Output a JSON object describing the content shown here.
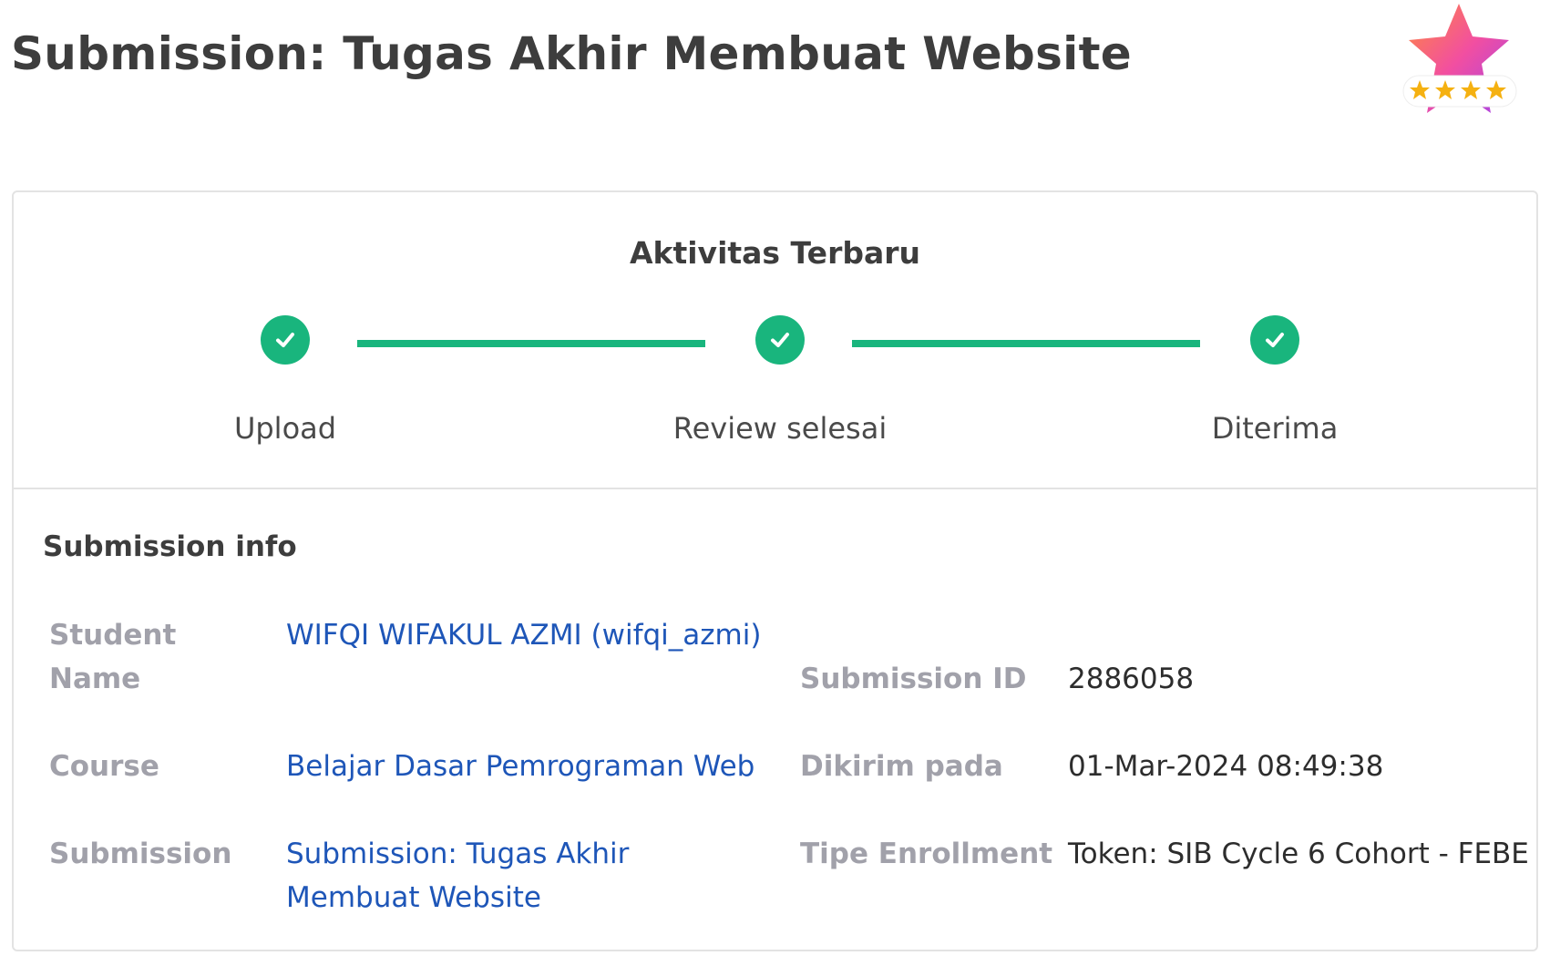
{
  "page": {
    "title": "Submission: Tugas Akhir Membuat Website"
  },
  "badge": {
    "icon": "star-rating-badge-icon",
    "stars": 4
  },
  "activity": {
    "title": "Aktivitas Terbaru",
    "steps": [
      {
        "label": "Upload",
        "status": "done"
      },
      {
        "label": "Review selesai",
        "status": "done"
      },
      {
        "label": "Diterima",
        "status": "done"
      }
    ],
    "accent_color": "#19b57d"
  },
  "info": {
    "title": "Submission info",
    "student_name_label_line1": "Student",
    "student_name_label_line2": "Name",
    "student_name_value": "WIFQI WIFAKUL AZMI (wifqi_azmi)",
    "course_label": "Course",
    "course_value": "Belajar Dasar Pemrograman Web",
    "submission_label": "Submission",
    "submission_value_line1": "Submission: Tugas Akhir",
    "submission_value_line2": "Membuat Website",
    "submission_id_label": "Submission ID",
    "submission_id_value": "2886058",
    "sent_label": "Dikirim pada",
    "sent_value": "01-Mar-2024 08:49:38",
    "enrollment_label": "Tipe Enrollment",
    "enrollment_value": "Token: SIB Cycle 6 Cohort - FEBE",
    "link_color": "#1e56b8"
  }
}
